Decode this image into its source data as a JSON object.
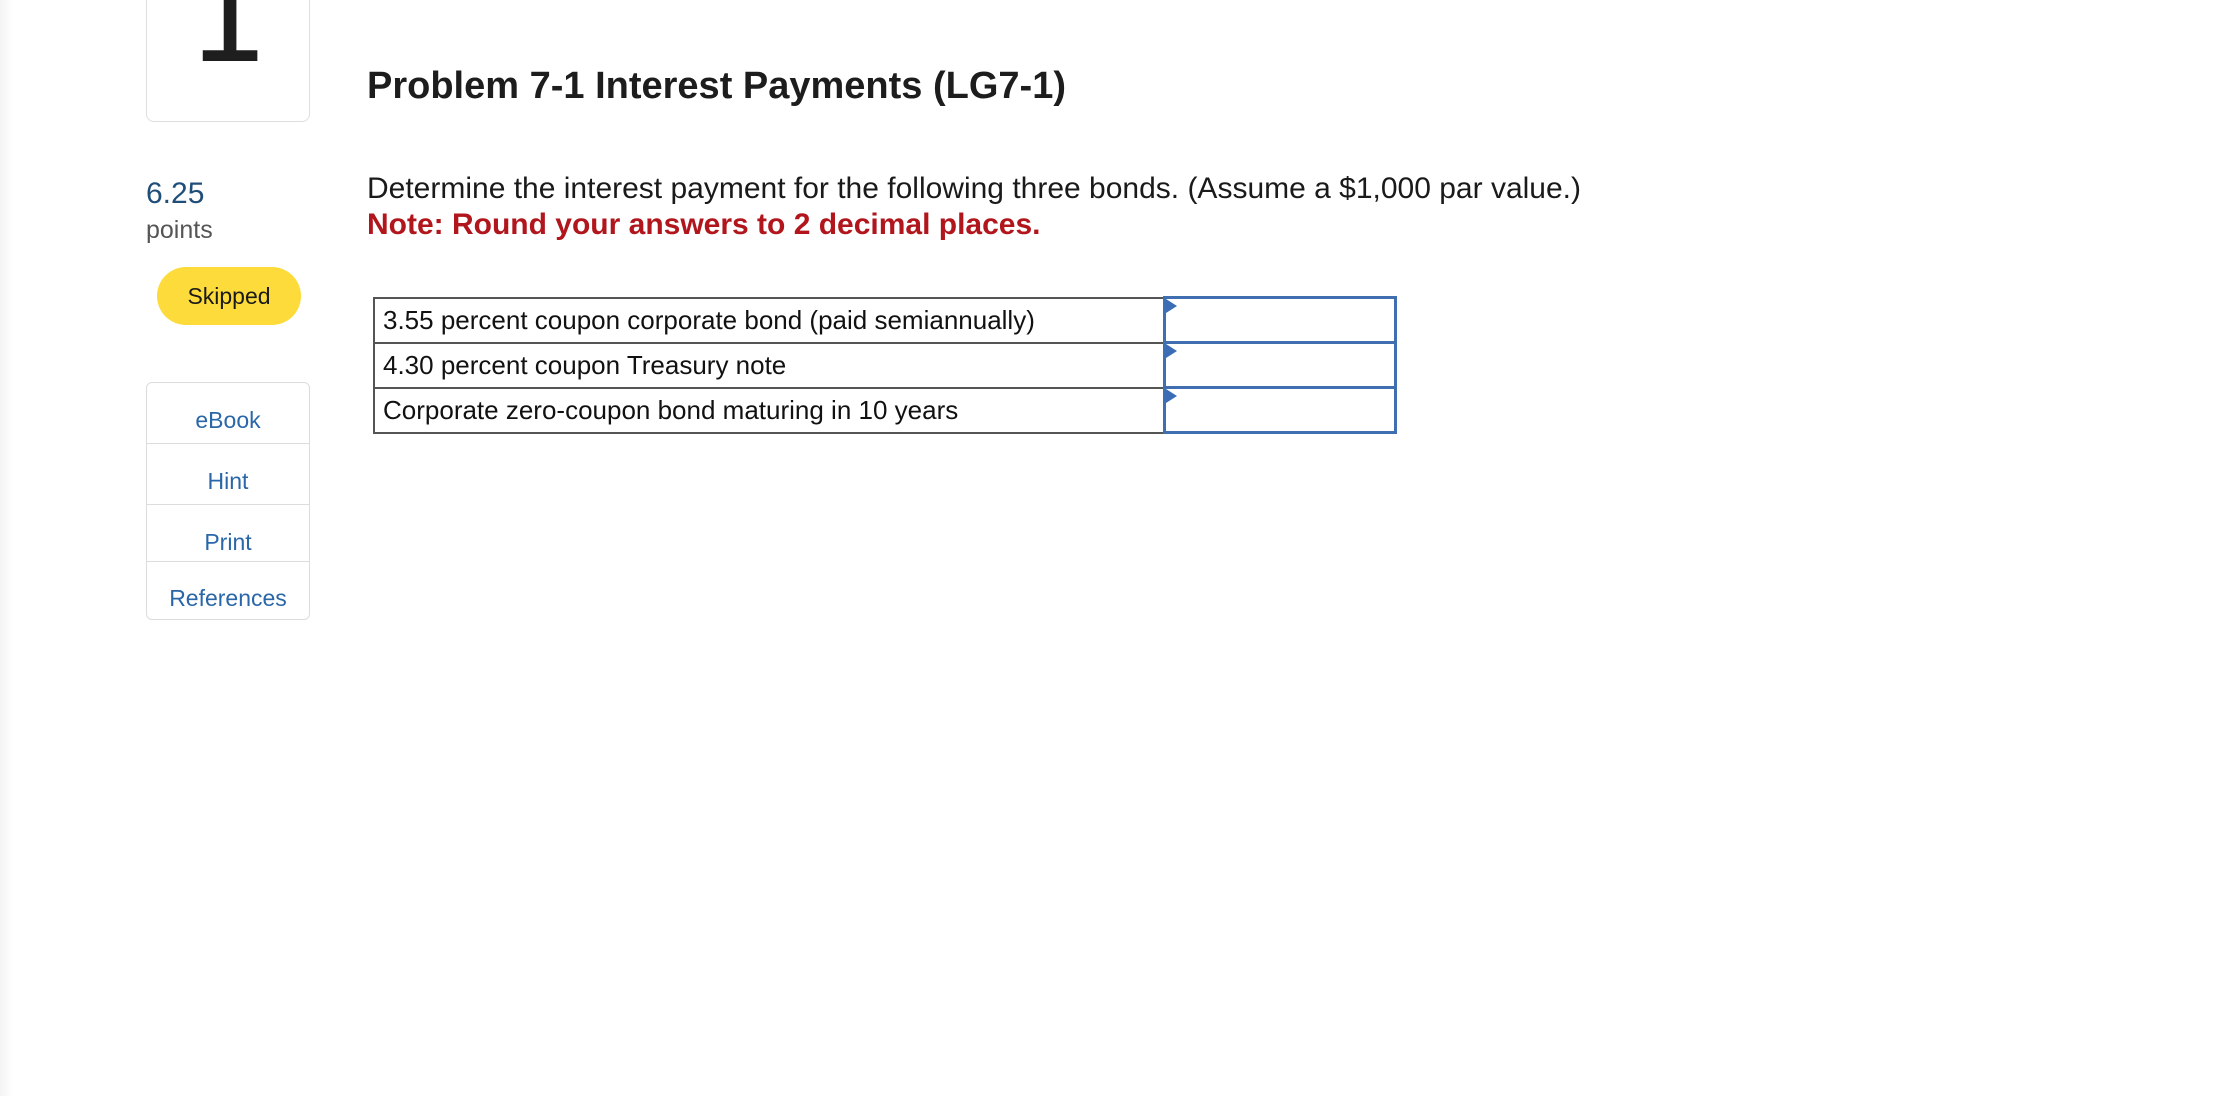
{
  "question": {
    "number": "1",
    "points_value": "6.25",
    "points_label": "points",
    "status": "Skipped"
  },
  "tools": [
    "eBook",
    "Hint",
    "Print",
    "References"
  ],
  "problem": {
    "title": "Problem 7-1 Interest Payments (LG7-1)",
    "instruction": "Determine the interest payment for the following three bonds. (Assume a $1,000 par value.)",
    "note": "Note: Round your answers to 2 decimal places."
  },
  "table": {
    "rows": [
      {
        "label": "3.55 percent coupon corporate bond (paid semiannually)",
        "value": ""
      },
      {
        "label": "4.30 percent coupon Treasury note",
        "value": ""
      },
      {
        "label": "Corporate zero-coupon bond maturing in 10 years",
        "value": ""
      }
    ]
  },
  "colors": {
    "accent_blue": "#2a67a8",
    "note_red": "#b0161c",
    "badge_yellow": "#fddb3a",
    "input_border": "#3f6fb0"
  }
}
